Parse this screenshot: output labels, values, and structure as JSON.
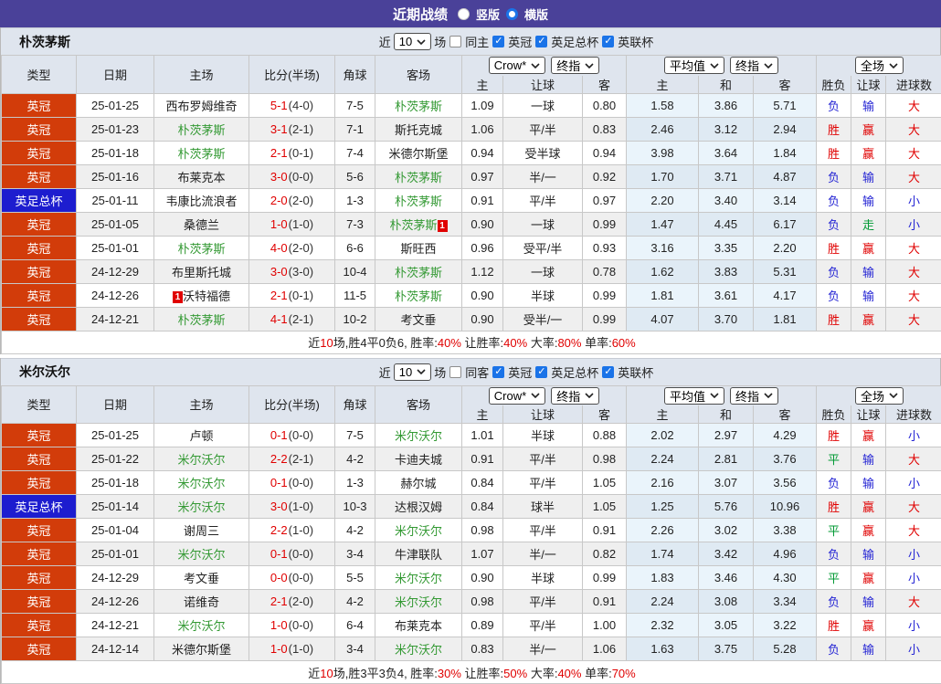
{
  "colors": {
    "accent": "#4a4199",
    "header_bg": "#dfe5ee",
    "league_badge": "#d23c0a",
    "cup_badge": "#1d1dcf",
    "focus_team": "#339933",
    "win_red": "#e00000",
    "loss_blue": "#2424d4",
    "draw_green": "#009933",
    "check_blue": "#1a73e8",
    "avg_col_bg": "#eaf4fb"
  },
  "topbar": {
    "title": "近期战绩",
    "radios": [
      {
        "label": "竖版",
        "checked": false
      },
      {
        "label": "横版",
        "checked": true
      }
    ]
  },
  "columns": {
    "type": "类型",
    "date": "日期",
    "home": "主场",
    "score": "比分(半场)",
    "corner": "角球",
    "away": "客场",
    "group1_select1": "Crow*",
    "group1_select2": "终指",
    "group2_select1": "平均值",
    "group2_select2": "终指",
    "group3_select1": "全场",
    "g1_home": "主",
    "g1_handicap": "让球",
    "g1_away": "客",
    "g2_home": "主",
    "g2_draw": "和",
    "g2_away": "客",
    "g3_result": "胜负",
    "g3_handicap": "让球",
    "g3_goals": "进球数"
  },
  "tables": [
    {
      "team": "朴茨茅斯",
      "filter": {
        "near": "近",
        "count": "10",
        "games": "场",
        "same_label": "同主",
        "same_checked": false,
        "leagues": [
          {
            "label": "英冠",
            "checked": true
          },
          {
            "label": "英足总杯",
            "checked": true
          },
          {
            "label": "英联杯",
            "checked": true
          }
        ]
      },
      "rows": [
        {
          "type": "英冠",
          "date": "25-01-25",
          "home": "西布罗姆维奇",
          "score": "5-1",
          "half": "(4-0)",
          "corner": "7-5",
          "away": "朴茨茅斯",
          "crow_home": "1.09",
          "handicap": "一球",
          "crow_away": "0.80",
          "avg_home": "1.58",
          "avg_draw": "3.86",
          "avg_away": "5.71",
          "res_win": "负",
          "res_hd": "输",
          "res_goal": "大"
        },
        {
          "type": "英冠",
          "date": "25-01-23",
          "home": "朴茨茅斯",
          "score": "3-1",
          "half": "(2-1)",
          "corner": "7-1",
          "away": "斯托克城",
          "crow_home": "1.06",
          "handicap": "平/半",
          "crow_away": "0.83",
          "avg_home": "2.46",
          "avg_draw": "3.12",
          "avg_away": "2.94",
          "res_win": "胜",
          "res_hd": "赢",
          "res_goal": "大"
        },
        {
          "type": "英冠",
          "date": "25-01-18",
          "home": "朴茨茅斯",
          "score": "2-1",
          "half": "(0-1)",
          "corner": "7-4",
          "away": "米德尔斯堡",
          "crow_home": "0.94",
          "handicap": "受半球",
          "crow_away": "0.94",
          "avg_home": "3.98",
          "avg_draw": "3.64",
          "avg_away": "1.84",
          "res_win": "胜",
          "res_hd": "赢",
          "res_goal": "大"
        },
        {
          "type": "英冠",
          "date": "25-01-16",
          "home": "布莱克本",
          "score": "3-0",
          "half": "(0-0)",
          "corner": "5-6",
          "away": "朴茨茅斯",
          "crow_home": "0.97",
          "handicap": "半/一",
          "crow_away": "0.92",
          "avg_home": "1.70",
          "avg_draw": "3.71",
          "avg_away": "4.87",
          "res_win": "负",
          "res_hd": "输",
          "res_goal": "大"
        },
        {
          "type": "英足总杯",
          "date": "25-01-11",
          "home": "韦康比流浪者",
          "score": "2-0",
          "half": "(2-0)",
          "corner": "1-3",
          "away": "朴茨茅斯",
          "crow_home": "0.91",
          "handicap": "平/半",
          "crow_away": "0.97",
          "avg_home": "2.20",
          "avg_draw": "3.40",
          "avg_away": "3.14",
          "res_win": "负",
          "res_hd": "输",
          "res_goal": "小"
        },
        {
          "type": "英冠",
          "date": "25-01-05",
          "home": "桑德兰",
          "score": "1-0",
          "half": "(1-0)",
          "corner": "7-3",
          "away": "朴茨茅斯",
          "away_card_suf": "1",
          "crow_home": "0.90",
          "handicap": "一球",
          "crow_away": "0.99",
          "avg_home": "1.47",
          "avg_draw": "4.45",
          "avg_away": "6.17",
          "res_win": "负",
          "res_hd": "走",
          "res_goal": "小"
        },
        {
          "type": "英冠",
          "date": "25-01-01",
          "home": "朴茨茅斯",
          "score": "4-0",
          "half": "(2-0)",
          "corner": "6-6",
          "away": "斯旺西",
          "crow_home": "0.96",
          "handicap": "受平/半",
          "crow_away": "0.93",
          "avg_home": "3.16",
          "avg_draw": "3.35",
          "avg_away": "2.20",
          "res_win": "胜",
          "res_hd": "赢",
          "res_goal": "大"
        },
        {
          "type": "英冠",
          "date": "24-12-29",
          "home": "布里斯托城",
          "score": "3-0",
          "half": "(3-0)",
          "corner": "10-4",
          "away": "朴茨茅斯",
          "crow_home": "1.12",
          "handicap": "一球",
          "crow_away": "0.78",
          "avg_home": "1.62",
          "avg_draw": "3.83",
          "avg_away": "5.31",
          "res_win": "负",
          "res_hd": "输",
          "res_goal": "大"
        },
        {
          "type": "英冠",
          "date": "24-12-26",
          "home": "沃特福德",
          "home_card_pre": "1",
          "score": "2-1",
          "half": "(0-1)",
          "corner": "11-5",
          "away": "朴茨茅斯",
          "crow_home": "0.90",
          "handicap": "半球",
          "crow_away": "0.99",
          "avg_home": "1.81",
          "avg_draw": "3.61",
          "avg_away": "4.17",
          "res_win": "负",
          "res_hd": "输",
          "res_goal": "大"
        },
        {
          "type": "英冠",
          "date": "24-12-21",
          "home": "朴茨茅斯",
          "score": "4-1",
          "half": "(2-1)",
          "corner": "10-2",
          "away": "考文垂",
          "crow_home": "0.90",
          "handicap": "受半/一",
          "crow_away": "0.99",
          "avg_home": "4.07",
          "avg_draw": "3.70",
          "avg_away": "1.81",
          "res_win": "胜",
          "res_hd": "赢",
          "res_goal": "大"
        }
      ],
      "summary_parts": [
        {
          "text": "近"
        },
        {
          "text": "10",
          "red": true
        },
        {
          "text": "场,胜4平0负6, 胜率:"
        },
        {
          "text": "40%",
          "red": true
        },
        {
          "text": " 让胜率:"
        },
        {
          "text": "40%",
          "red": true
        },
        {
          "text": " 大率:"
        },
        {
          "text": "80%",
          "red": true
        },
        {
          "text": " 单率:"
        },
        {
          "text": "60%",
          "red": true
        }
      ]
    },
    {
      "team": "米尔沃尔",
      "filter": {
        "near": "近",
        "count": "10",
        "games": "场",
        "same_label": "同客",
        "same_checked": false,
        "leagues": [
          {
            "label": "英冠",
            "checked": true
          },
          {
            "label": "英足总杯",
            "checked": true
          },
          {
            "label": "英联杯",
            "checked": true
          }
        ]
      },
      "rows": [
        {
          "type": "英冠",
          "date": "25-01-25",
          "home": "卢顿",
          "score": "0-1",
          "half": "(0-0)",
          "corner": "7-5",
          "away": "米尔沃尔",
          "crow_home": "1.01",
          "handicap": "半球",
          "crow_away": "0.88",
          "avg_home": "2.02",
          "avg_draw": "2.97",
          "avg_away": "4.29",
          "res_win": "胜",
          "res_hd": "赢",
          "res_goal": "小"
        },
        {
          "type": "英冠",
          "date": "25-01-22",
          "home": "米尔沃尔",
          "score": "2-2",
          "half": "(2-1)",
          "corner": "4-2",
          "away": "卡迪夫城",
          "crow_home": "0.91",
          "handicap": "平/半",
          "crow_away": "0.98",
          "avg_home": "2.24",
          "avg_draw": "2.81",
          "avg_away": "3.76",
          "res_win": "平",
          "res_hd": "输",
          "res_goal": "大"
        },
        {
          "type": "英冠",
          "date": "25-01-18",
          "home": "米尔沃尔",
          "score": "0-1",
          "half": "(0-0)",
          "corner": "1-3",
          "away": "赫尔城",
          "crow_home": "0.84",
          "handicap": "平/半",
          "crow_away": "1.05",
          "avg_home": "2.16",
          "avg_draw": "3.07",
          "avg_away": "3.56",
          "res_win": "负",
          "res_hd": "输",
          "res_goal": "小"
        },
        {
          "type": "英足总杯",
          "date": "25-01-14",
          "home": "米尔沃尔",
          "score": "3-0",
          "half": "(1-0)",
          "corner": "10-3",
          "away": "达根汉姆",
          "crow_home": "0.84",
          "handicap": "球半",
          "crow_away": "1.05",
          "avg_home": "1.25",
          "avg_draw": "5.76",
          "avg_away": "10.96",
          "res_win": "胜",
          "res_hd": "赢",
          "res_goal": "大"
        },
        {
          "type": "英冠",
          "date": "25-01-04",
          "home": "谢周三",
          "score": "2-2",
          "half": "(1-0)",
          "corner": "4-2",
          "away": "米尔沃尔",
          "crow_home": "0.98",
          "handicap": "平/半",
          "crow_away": "0.91",
          "avg_home": "2.26",
          "avg_draw": "3.02",
          "avg_away": "3.38",
          "res_win": "平",
          "res_hd": "赢",
          "res_goal": "大"
        },
        {
          "type": "英冠",
          "date": "25-01-01",
          "home": "米尔沃尔",
          "score": "0-1",
          "half": "(0-0)",
          "corner": "3-4",
          "away": "牛津联队",
          "crow_home": "1.07",
          "handicap": "半/一",
          "crow_away": "0.82",
          "avg_home": "1.74",
          "avg_draw": "3.42",
          "avg_away": "4.96",
          "res_win": "负",
          "res_hd": "输",
          "res_goal": "小"
        },
        {
          "type": "英冠",
          "date": "24-12-29",
          "home": "考文垂",
          "score": "0-0",
          "half": "(0-0)",
          "corner": "5-5",
          "away": "米尔沃尔",
          "crow_home": "0.90",
          "handicap": "半球",
          "crow_away": "0.99",
          "avg_home": "1.83",
          "avg_draw": "3.46",
          "avg_away": "4.30",
          "res_win": "平",
          "res_hd": "赢",
          "res_goal": "小"
        },
        {
          "type": "英冠",
          "date": "24-12-26",
          "home": "诺维奇",
          "score": "2-1",
          "half": "(2-0)",
          "corner": "4-2",
          "away": "米尔沃尔",
          "crow_home": "0.98",
          "handicap": "平/半",
          "crow_away": "0.91",
          "avg_home": "2.24",
          "avg_draw": "3.08",
          "avg_away": "3.34",
          "res_win": "负",
          "res_hd": "输",
          "res_goal": "大"
        },
        {
          "type": "英冠",
          "date": "24-12-21",
          "home": "米尔沃尔",
          "score": "1-0",
          "half": "(0-0)",
          "corner": "6-4",
          "away": "布莱克本",
          "crow_home": "0.89",
          "handicap": "平/半",
          "crow_away": "1.00",
          "avg_home": "2.32",
          "avg_draw": "3.05",
          "avg_away": "3.22",
          "res_win": "胜",
          "res_hd": "赢",
          "res_goal": "小"
        },
        {
          "type": "英冠",
          "date": "24-12-14",
          "home": "米德尔斯堡",
          "score": "1-0",
          "half": "(1-0)",
          "corner": "3-4",
          "away": "米尔沃尔",
          "crow_home": "0.83",
          "handicap": "半/一",
          "crow_away": "1.06",
          "avg_home": "1.63",
          "avg_draw": "3.75",
          "avg_away": "5.28",
          "res_win": "负",
          "res_hd": "输",
          "res_goal": "小"
        }
      ],
      "summary_parts": [
        {
          "text": "近"
        },
        {
          "text": "10",
          "red": true
        },
        {
          "text": "场,胜3平3负4, 胜率:"
        },
        {
          "text": "30%",
          "red": true
        },
        {
          "text": " 让胜率:"
        },
        {
          "text": "50%",
          "red": true
        },
        {
          "text": " 大率:"
        },
        {
          "text": "40%",
          "red": true
        },
        {
          "text": " 单率:"
        },
        {
          "text": "70%",
          "red": true
        }
      ]
    }
  ]
}
